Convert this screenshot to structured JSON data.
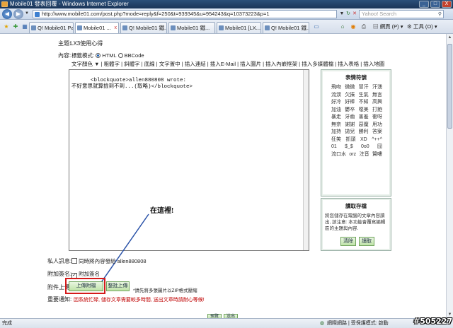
{
  "window": {
    "title": "Mobile01 發表回覆 - Windows Internet Explorer",
    "minimize": "_",
    "maximize": "□",
    "close": "X"
  },
  "address": {
    "url": "http://www.mobile01.com/post.php?mode=reply&f=250&t=939345&u=954243&q=10373223&p=1",
    "search_placeholder": "Yahoo! Search"
  },
  "tabs": [
    {
      "label": "Q! Mobile01 Pan..."
    },
    {
      "label": "Mobile01 ..."
    },
    {
      "label": "Q! Mobile01 鐵..."
    },
    {
      "label": "Mobile01 鐵..."
    },
    {
      "label": "Mobile01 [LX..."
    },
    {
      "label": "Q! Mobile01 鐵..."
    }
  ],
  "commands": {
    "page": "網頁 (P)",
    "tools": "工具 (O)"
  },
  "form": {
    "subject_label": "主題:",
    "subject_value": "LX3使用心得",
    "content_label": "內容:",
    "mode_label": "標籤模式:",
    "mode_html": "HTML",
    "mode_bbcode": "BBCode",
    "toolbar": [
      "文字顏色 ▼",
      "粗體字",
      "斜體字",
      "底線",
      "文字置中",
      "插入連結",
      "插入E-Mail",
      "插入圖片",
      "插入內嵌框架",
      "插入多媒體檔",
      "插入表格",
      "插入地圖"
    ],
    "editor_text": "<blockquote>allen880808 wrote:\n不好意思就算撿到不到...(取略)</blockquote>",
    "private_label": "私人訊息:",
    "private_checkbox": "同時將內容發給 allen880808",
    "signature_label": "附加簽名:",
    "signature_checkbox": "附加簽名",
    "attach_label": "附件上傳:",
    "upload_button": "上傳附檔",
    "batch_button": "整批上傳",
    "attach_note": "*請先將多張圖片以ZIP格式壓縮",
    "notice_label": "重要通知:",
    "notice_text": "因系統忙碌, 儲存文章需要較多時間, 送出文章時請耐心等候!",
    "submit_button": "預覽",
    "send_button": "送出"
  },
  "emoticons": {
    "title": "表情符號",
    "rows": [
      [
        "飛吻",
        "微微",
        "冒汗",
        "汗湧"
      ],
      [
        "流淚",
        "欠揍",
        "生氣",
        "無言"
      ],
      [
        "好冷",
        "好棒",
        "不知",
        "高興"
      ],
      [
        "加油",
        "鬱卒",
        "噁美",
        "打飽"
      ],
      [
        "暴走",
        "牙齒",
        "害羞",
        "衝呀"
      ],
      [
        "無奈",
        "謝謝",
        "惡魔",
        "用功"
      ],
      [
        "加持",
        "拋兒",
        "勝利",
        "答案"
      ],
      [
        "狂笑",
        "抓頭",
        "XD",
        "^++^"
      ],
      [
        "01",
        "$_$",
        "0o0",
        "囧"
      ],
      [
        "流口水",
        "orz",
        "注音",
        "贊嘍"
      ]
    ]
  },
  "draft": {
    "title": "讀取存檔",
    "text": "將您儲存在電腦的文章內容讀出, 該注意: 本功能會覆寫編輯區的主題與內容.",
    "clear_button": "清除",
    "read_button": "讀取"
  },
  "annotation": {
    "text": "在這裡!"
  },
  "status": {
    "left": "完成",
    "zone": "網際網路 | 受保護模式: 啟動",
    "zoom": "100%"
  },
  "watermark": "#505227",
  "colors": {
    "notice_red": "#c00000",
    "highlight_red": "#d41a1a",
    "arrow_blue": "#2a52a8"
  }
}
